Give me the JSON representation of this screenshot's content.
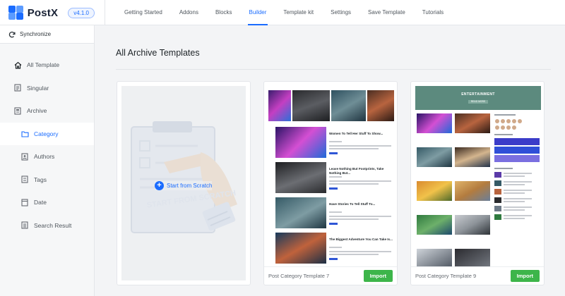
{
  "brand": {
    "name": "PostX",
    "version": "v4.1.0"
  },
  "nav": [
    {
      "label": "Getting Started",
      "active": false
    },
    {
      "label": "Addons",
      "active": false
    },
    {
      "label": "Blocks",
      "active": false
    },
    {
      "label": "Builder",
      "active": true
    },
    {
      "label": "Template kit",
      "active": false
    },
    {
      "label": "Settings",
      "active": false
    },
    {
      "label": "Save Template",
      "active": false
    },
    {
      "label": "Tutorials",
      "active": false
    }
  ],
  "sidebar": {
    "sync_label": "Synchronize",
    "items": [
      {
        "label": "All Template",
        "icon": "home-icon",
        "active": false
      },
      {
        "label": "Singular",
        "icon": "document-icon",
        "active": false
      },
      {
        "label": "Archive",
        "icon": "archive-icon",
        "active": false
      },
      {
        "label": "Category",
        "icon": "folder-icon",
        "active": true
      },
      {
        "label": "Authors",
        "icon": "user-icon",
        "active": false
      },
      {
        "label": "Tags",
        "icon": "tag-icon",
        "active": false
      },
      {
        "label": "Date",
        "icon": "calendar-icon",
        "active": false
      },
      {
        "label": "Search Result",
        "icon": "search-icon",
        "active": false
      }
    ]
  },
  "main": {
    "title": "All Archive Templates",
    "scratch": {
      "label": "Start from Scratch",
      "art_text": "START FROM SCRATCH"
    },
    "cards": [
      {
        "name": "Post Category Template 7",
        "import_label": "Import",
        "posts": [
          "Women To Tell Her Stuff To Show...",
          "Leave Nothing But Footprints, Take Nothing But...",
          "Have Stories To Tell Stuff To...",
          "The Biggest Adventure You Can Take Is..."
        ]
      },
      {
        "name": "Post Category Template 9",
        "import_label": "Import",
        "header_title": "ENTERTAINMENT",
        "header_sub": "READ MORE"
      }
    ]
  },
  "colors": {
    "accent": "#1a6cff",
    "import": "#3db54a",
    "template9_header": "#5c8a7e"
  }
}
